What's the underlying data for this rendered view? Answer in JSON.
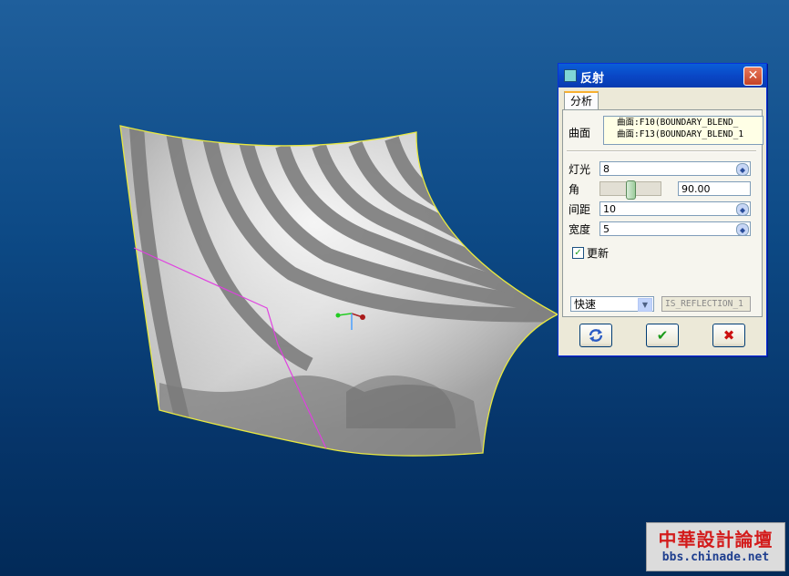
{
  "dialog": {
    "title": "反射",
    "close_label": "✕",
    "tab": "分析",
    "surface_label": "曲面",
    "surfaces": [
      "曲面:F10(BOUNDARY_BLEND_",
      "曲面:F13(BOUNDARY_BLEND_1"
    ],
    "light_label": "灯光",
    "light_value": "8",
    "angle_label": "角",
    "angle_value": "90.00",
    "angle_slider_fraction": 0.5,
    "spacing_label": "间距",
    "spacing_value": "10",
    "width_label": "宽度",
    "width_value": "5",
    "update_label": "更新",
    "update_checked": true,
    "mode_value": "快速",
    "result_name": "IS_REFLECTION_1",
    "buttons": {
      "refresh": "refresh-icon",
      "ok": "✔",
      "cancel": "✖"
    }
  },
  "watermark": {
    "top": "中華設計論壇",
    "bottom": "bbs.chinade.net"
  },
  "colors": {
    "surface_edge": "#e8e840",
    "section_line": "#e040e0",
    "ok_color": "#1a9a1a",
    "cancel_color": "#cc1111"
  }
}
